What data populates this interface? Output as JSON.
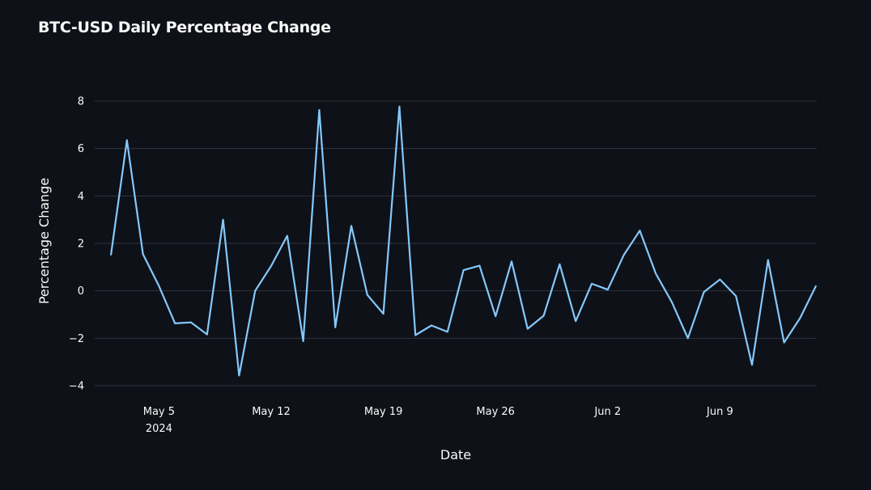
{
  "colors": {
    "background": "#0e1117",
    "line": "#83c9ff",
    "grid": "#31333f",
    "text": "#fafafa"
  },
  "chart_data": {
    "type": "line",
    "title": "BTC-USD Daily Percentage Change",
    "xlabel": "Date",
    "ylabel": "Percentage Change",
    "ylim": [
      -4,
      8
    ],
    "y_ticks": [
      8,
      6,
      4,
      2,
      0,
      -2,
      -4
    ],
    "y_tick_labels": [
      "8",
      "6",
      "4",
      "2",
      "0",
      "−2",
      "−4"
    ],
    "x_range": [
      "2024-05-02",
      "2024-06-15"
    ],
    "x_ticks": [
      {
        "date": "2024-05-05",
        "label": "May 5",
        "sublabel": "2024"
      },
      {
        "date": "2024-05-12",
        "label": "May 12",
        "sublabel": ""
      },
      {
        "date": "2024-05-19",
        "label": "May 19",
        "sublabel": ""
      },
      {
        "date": "2024-05-26",
        "label": "May 26",
        "sublabel": ""
      },
      {
        "date": "2024-06-02",
        "label": "Jun 2",
        "sublabel": ""
      },
      {
        "date": "2024-06-09",
        "label": "Jun 9",
        "sublabel": ""
      }
    ],
    "grid": true,
    "series": [
      {
        "x": [
          "2024-05-02",
          "2024-05-03",
          "2024-05-04",
          "2024-05-05",
          "2024-05-06",
          "2024-05-07",
          "2024-05-08",
          "2024-05-09",
          "2024-05-10",
          "2024-05-11",
          "2024-05-12",
          "2024-05-13",
          "2024-05-14",
          "2024-05-15",
          "2024-05-16",
          "2024-05-17",
          "2024-05-18",
          "2024-05-19",
          "2024-05-20",
          "2024-05-21",
          "2024-05-22",
          "2024-05-23",
          "2024-05-24",
          "2024-05-25",
          "2024-05-26",
          "2024-05-27",
          "2024-05-28",
          "2024-05-29",
          "2024-05-30",
          "2024-05-31",
          "2024-06-01",
          "2024-06-02",
          "2024-06-03",
          "2024-06-04",
          "2024-06-05",
          "2024-06-06",
          "2024-06-07",
          "2024-06-08",
          "2024-06-09",
          "2024-06-10",
          "2024-06-11",
          "2024-06-12",
          "2024-06-13",
          "2024-06-14",
          "2024-06-15"
        ],
        "values": [
          1.5,
          6.35,
          1.55,
          0.2,
          -1.37,
          -1.33,
          -1.84,
          3.0,
          -3.57,
          0.0,
          1.05,
          2.32,
          -2.12,
          7.62,
          -1.54,
          2.74,
          -0.17,
          -0.97,
          7.77,
          -1.87,
          -1.46,
          -1.73,
          0.87,
          1.06,
          -1.07,
          1.24,
          -1.6,
          -1.05,
          1.12,
          -1.28,
          0.3,
          0.05,
          1.51,
          2.54,
          0.72,
          -0.48,
          -2.0,
          -0.05,
          0.48,
          -0.22,
          -3.12,
          1.3,
          -2.18,
          -1.15,
          0.22
        ]
      }
    ]
  }
}
